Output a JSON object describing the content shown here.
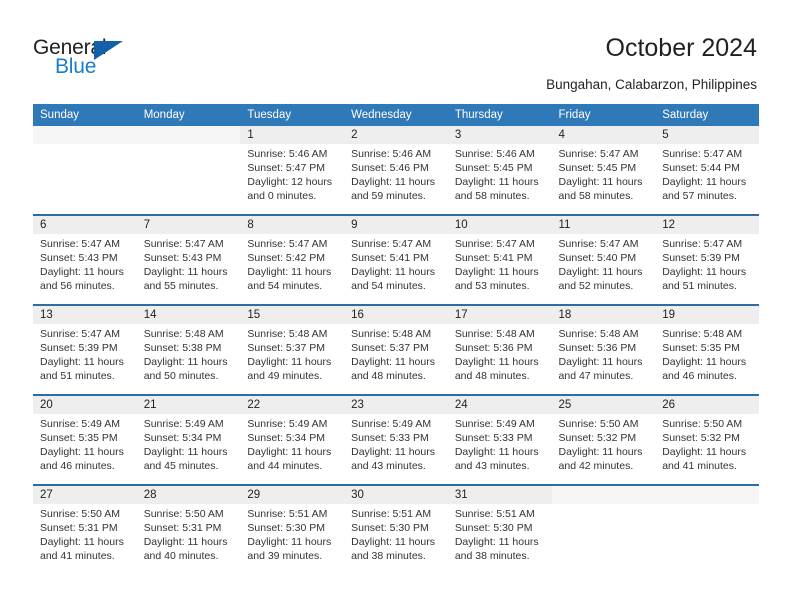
{
  "logo": {
    "word_top": "General",
    "word_bottom": "Blue",
    "triangle_color": "#1260a8",
    "blue_text_color": "#1a7ec8",
    "dark_text_color": "#231f20"
  },
  "header": {
    "title": "October 2024",
    "subtitle": "Bungahan, Calabarzon, Philippines"
  },
  "theme": {
    "header_blue": "#3079b8",
    "week_separator": "#2e6ca4",
    "datenum_band": "#eeeeee",
    "body_text": "#333333"
  },
  "calendar": {
    "daynames": [
      "Sunday",
      "Monday",
      "Tuesday",
      "Wednesday",
      "Thursday",
      "Friday",
      "Saturday"
    ],
    "weeks": [
      [
        {
          "day": "",
          "lines": []
        },
        {
          "day": "",
          "lines": []
        },
        {
          "day": "1",
          "lines": [
            "Sunrise: 5:46 AM",
            "Sunset: 5:47 PM",
            "Daylight: 12 hours",
            "and 0 minutes."
          ]
        },
        {
          "day": "2",
          "lines": [
            "Sunrise: 5:46 AM",
            "Sunset: 5:46 PM",
            "Daylight: 11 hours",
            "and 59 minutes."
          ]
        },
        {
          "day": "3",
          "lines": [
            "Sunrise: 5:46 AM",
            "Sunset: 5:45 PM",
            "Daylight: 11 hours",
            "and 58 minutes."
          ]
        },
        {
          "day": "4",
          "lines": [
            "Sunrise: 5:47 AM",
            "Sunset: 5:45 PM",
            "Daylight: 11 hours",
            "and 58 minutes."
          ]
        },
        {
          "day": "5",
          "lines": [
            "Sunrise: 5:47 AM",
            "Sunset: 5:44 PM",
            "Daylight: 11 hours",
            "and 57 minutes."
          ]
        }
      ],
      [
        {
          "day": "6",
          "lines": [
            "Sunrise: 5:47 AM",
            "Sunset: 5:43 PM",
            "Daylight: 11 hours",
            "and 56 minutes."
          ]
        },
        {
          "day": "7",
          "lines": [
            "Sunrise: 5:47 AM",
            "Sunset: 5:43 PM",
            "Daylight: 11 hours",
            "and 55 minutes."
          ]
        },
        {
          "day": "8",
          "lines": [
            "Sunrise: 5:47 AM",
            "Sunset: 5:42 PM",
            "Daylight: 11 hours",
            "and 54 minutes."
          ]
        },
        {
          "day": "9",
          "lines": [
            "Sunrise: 5:47 AM",
            "Sunset: 5:41 PM",
            "Daylight: 11 hours",
            "and 54 minutes."
          ]
        },
        {
          "day": "10",
          "lines": [
            "Sunrise: 5:47 AM",
            "Sunset: 5:41 PM",
            "Daylight: 11 hours",
            "and 53 minutes."
          ]
        },
        {
          "day": "11",
          "lines": [
            "Sunrise: 5:47 AM",
            "Sunset: 5:40 PM",
            "Daylight: 11 hours",
            "and 52 minutes."
          ]
        },
        {
          "day": "12",
          "lines": [
            "Sunrise: 5:47 AM",
            "Sunset: 5:39 PM",
            "Daylight: 11 hours",
            "and 51 minutes."
          ]
        }
      ],
      [
        {
          "day": "13",
          "lines": [
            "Sunrise: 5:47 AM",
            "Sunset: 5:39 PM",
            "Daylight: 11 hours",
            "and 51 minutes."
          ]
        },
        {
          "day": "14",
          "lines": [
            "Sunrise: 5:48 AM",
            "Sunset: 5:38 PM",
            "Daylight: 11 hours",
            "and 50 minutes."
          ]
        },
        {
          "day": "15",
          "lines": [
            "Sunrise: 5:48 AM",
            "Sunset: 5:37 PM",
            "Daylight: 11 hours",
            "and 49 minutes."
          ]
        },
        {
          "day": "16",
          "lines": [
            "Sunrise: 5:48 AM",
            "Sunset: 5:37 PM",
            "Daylight: 11 hours",
            "and 48 minutes."
          ]
        },
        {
          "day": "17",
          "lines": [
            "Sunrise: 5:48 AM",
            "Sunset: 5:36 PM",
            "Daylight: 11 hours",
            "and 48 minutes."
          ]
        },
        {
          "day": "18",
          "lines": [
            "Sunrise: 5:48 AM",
            "Sunset: 5:36 PM",
            "Daylight: 11 hours",
            "and 47 minutes."
          ]
        },
        {
          "day": "19",
          "lines": [
            "Sunrise: 5:48 AM",
            "Sunset: 5:35 PM",
            "Daylight: 11 hours",
            "and 46 minutes."
          ]
        }
      ],
      [
        {
          "day": "20",
          "lines": [
            "Sunrise: 5:49 AM",
            "Sunset: 5:35 PM",
            "Daylight: 11 hours",
            "and 46 minutes."
          ]
        },
        {
          "day": "21",
          "lines": [
            "Sunrise: 5:49 AM",
            "Sunset: 5:34 PM",
            "Daylight: 11 hours",
            "and 45 minutes."
          ]
        },
        {
          "day": "22",
          "lines": [
            "Sunrise: 5:49 AM",
            "Sunset: 5:34 PM",
            "Daylight: 11 hours",
            "and 44 minutes."
          ]
        },
        {
          "day": "23",
          "lines": [
            "Sunrise: 5:49 AM",
            "Sunset: 5:33 PM",
            "Daylight: 11 hours",
            "and 43 minutes."
          ]
        },
        {
          "day": "24",
          "lines": [
            "Sunrise: 5:49 AM",
            "Sunset: 5:33 PM",
            "Daylight: 11 hours",
            "and 43 minutes."
          ]
        },
        {
          "day": "25",
          "lines": [
            "Sunrise: 5:50 AM",
            "Sunset: 5:32 PM",
            "Daylight: 11 hours",
            "and 42 minutes."
          ]
        },
        {
          "day": "26",
          "lines": [
            "Sunrise: 5:50 AM",
            "Sunset: 5:32 PM",
            "Daylight: 11 hours",
            "and 41 minutes."
          ]
        }
      ],
      [
        {
          "day": "27",
          "lines": [
            "Sunrise: 5:50 AM",
            "Sunset: 5:31 PM",
            "Daylight: 11 hours",
            "and 41 minutes."
          ]
        },
        {
          "day": "28",
          "lines": [
            "Sunrise: 5:50 AM",
            "Sunset: 5:31 PM",
            "Daylight: 11 hours",
            "and 40 minutes."
          ]
        },
        {
          "day": "29",
          "lines": [
            "Sunrise: 5:51 AM",
            "Sunset: 5:30 PM",
            "Daylight: 11 hours",
            "and 39 minutes."
          ]
        },
        {
          "day": "30",
          "lines": [
            "Sunrise: 5:51 AM",
            "Sunset: 5:30 PM",
            "Daylight: 11 hours",
            "and 38 minutes."
          ]
        },
        {
          "day": "31",
          "lines": [
            "Sunrise: 5:51 AM",
            "Sunset: 5:30 PM",
            "Daylight: 11 hours",
            "and 38 minutes."
          ]
        },
        {
          "day": "",
          "lines": []
        },
        {
          "day": "",
          "lines": []
        }
      ]
    ]
  }
}
